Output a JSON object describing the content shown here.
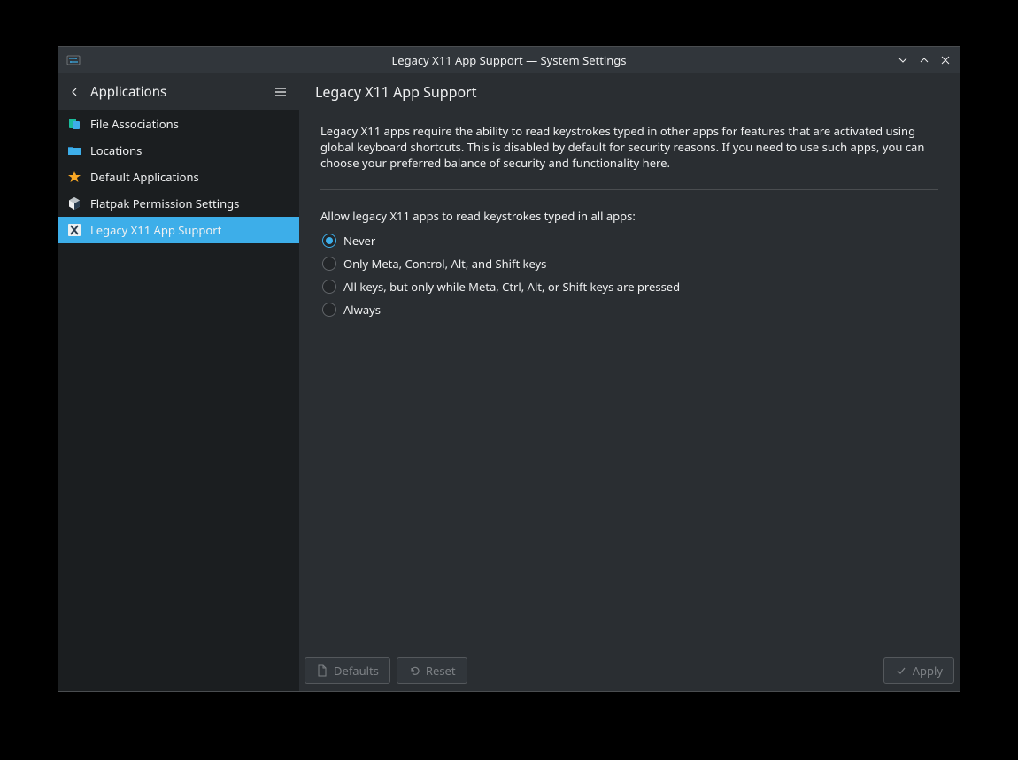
{
  "titlebar": {
    "title": "Legacy X11 App Support — System Settings"
  },
  "sidebar": {
    "back_label": "Applications",
    "items": [
      {
        "label": "File Associations",
        "icon": "file-assoc-icon"
      },
      {
        "label": "Locations",
        "icon": "folder-icon"
      },
      {
        "label": "Default Applications",
        "icon": "star-icon"
      },
      {
        "label": "Flatpak Permission Settings",
        "icon": "flatpak-icon"
      },
      {
        "label": "Legacy X11 App Support",
        "icon": "x11-icon"
      }
    ]
  },
  "page": {
    "title": "Legacy X11 App Support",
    "description": "Legacy X11 apps require the ability to read keystrokes typed in other apps for features that are activated using global keyboard shortcuts. This is disabled by default for security reasons. If you need to use such apps, you can choose your preferred balance of security and functionality here.",
    "question": "Allow legacy X11 apps to read keystrokes typed in all apps:",
    "options": [
      "Never",
      "Only Meta, Control, Alt, and Shift keys",
      "All keys, but only while Meta, Ctrl, Alt, or Shift keys are pressed",
      "Always"
    ],
    "selected": 0
  },
  "footer": {
    "defaults": "Defaults",
    "reset": "Reset",
    "apply": "Apply"
  }
}
